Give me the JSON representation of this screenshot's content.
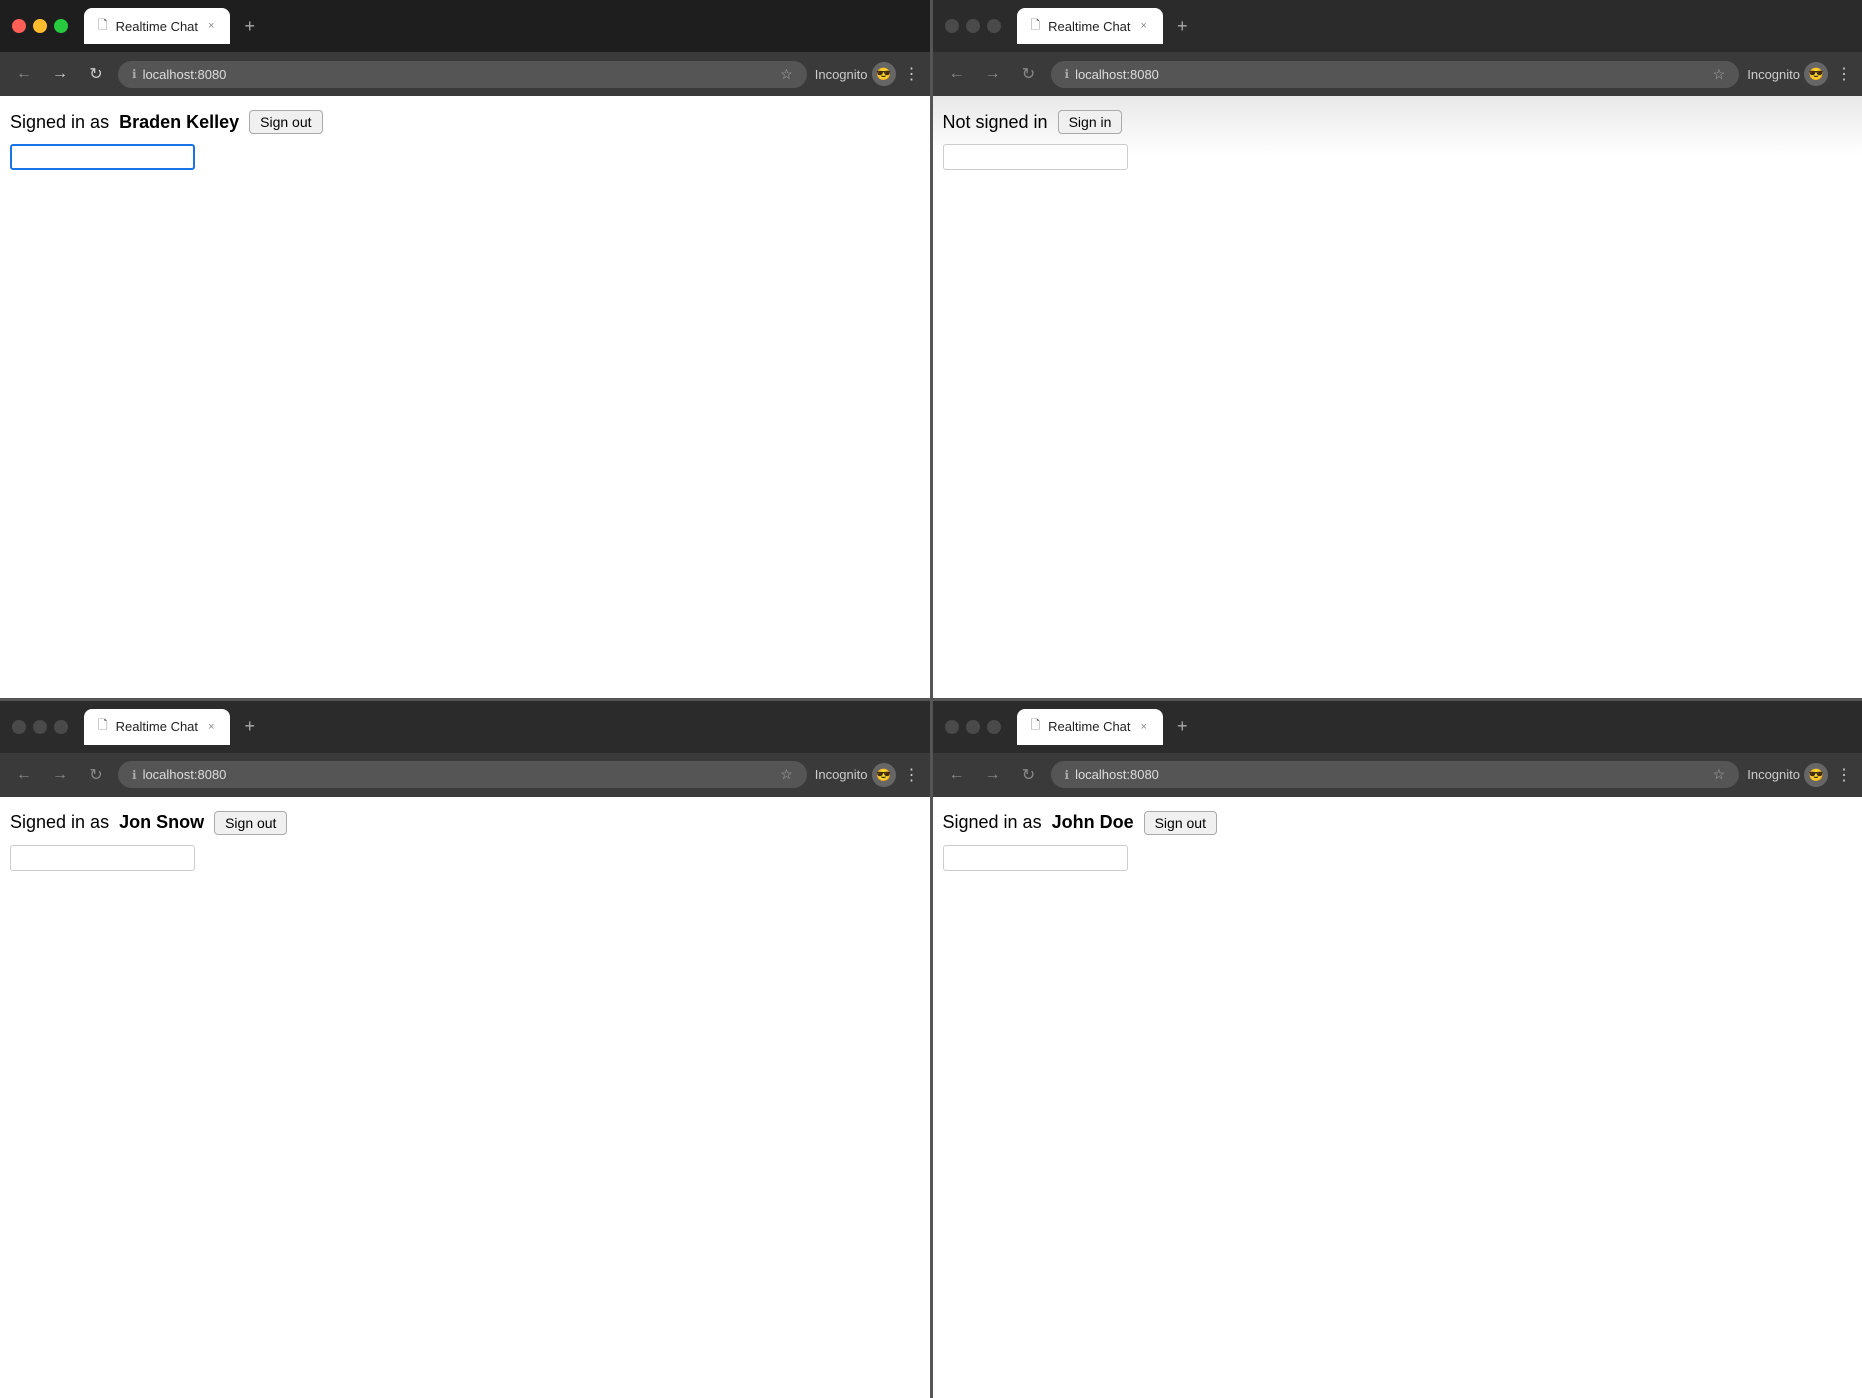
{
  "windows": [
    {
      "id": "top-left",
      "active": true,
      "tab_title": "Realtime Chat",
      "url": "localhost:8080",
      "signed_in": true,
      "username": "Braden Kelley",
      "status_text": "Signed in as",
      "sign_out_label": "Sign out",
      "input_active": true,
      "incognito_label": "Incognito"
    },
    {
      "id": "top-right",
      "active": false,
      "tab_title": "Realtime Chat",
      "url": "localhost:8080",
      "signed_in": false,
      "status_text": "Not signed in",
      "sign_in_label": "Sign in",
      "input_active": false,
      "incognito_label": "Incognito"
    },
    {
      "id": "bottom-left",
      "active": false,
      "tab_title": "Realtime Chat",
      "url": "localhost:8080",
      "signed_in": true,
      "username": "Jon Snow",
      "status_text": "Signed in as",
      "sign_out_label": "Sign out",
      "input_active": false,
      "incognito_label": "Incognito"
    },
    {
      "id": "bottom-right",
      "active": false,
      "tab_title": "Realtime Chat",
      "url": "localhost:8080",
      "signed_in": true,
      "username": "John Doe",
      "status_text": "Signed in as",
      "sign_out_label": "Sign out",
      "input_active": false,
      "incognito_label": "Incognito"
    }
  ],
  "nav": {
    "back": "←",
    "forward": "→",
    "reload": "↻",
    "new_tab": "+",
    "close_tab": "×",
    "info_icon": "ℹ",
    "star_icon": "☆",
    "menu_icon": "⋮"
  }
}
